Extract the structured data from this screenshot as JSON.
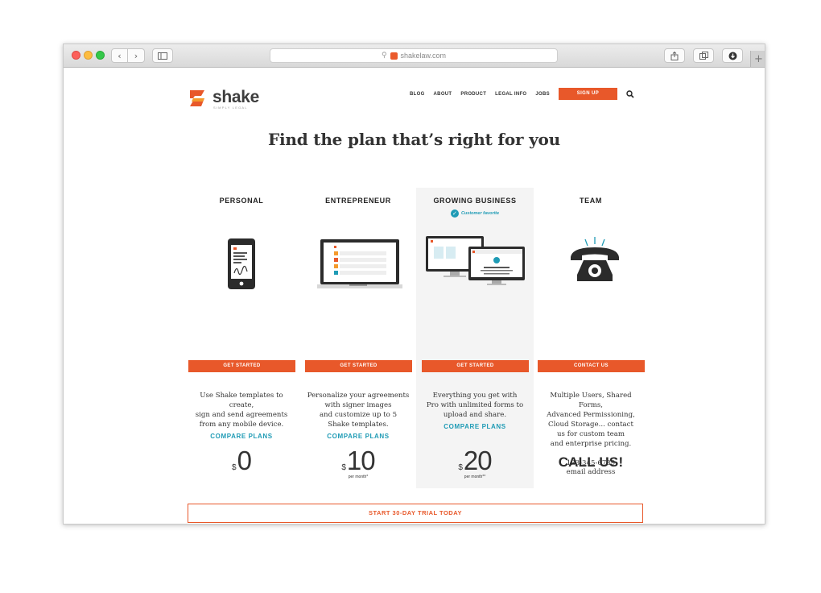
{
  "browser": {
    "url": "shakelaw.com",
    "back_glyph": "‹",
    "forward_glyph": "›",
    "new_tab_glyph": "+"
  },
  "header": {
    "logo_word": "shake",
    "logo_tagline": "SIMPLY LEGAL",
    "nav": [
      "BLOG",
      "ABOUT",
      "PRODUCT",
      "LEGAL INFO",
      "JOBS"
    ],
    "signup_label": "SIGN UP"
  },
  "headline": "Find the plan that’s right for you",
  "plans": [
    {
      "name": "PERSONAL",
      "currency": "$",
      "amount": "0",
      "period": "",
      "cta": "GET STARTED",
      "description": [
        "Use Shake templates to create,",
        "sign and send agreements",
        "from any mobile device."
      ],
      "compare": "COMPARE PLANS"
    },
    {
      "name": "ENTREPRENEUR",
      "currency": "$",
      "amount": "10",
      "period": "per month*",
      "cta": "GET STARTED",
      "description": [
        "Personalize your agreements",
        "with signer images",
        "and customize up to 5",
        "Shake templates."
      ],
      "compare": "COMPARE PLANS"
    },
    {
      "name": "GROWING BUSINESS",
      "badge": "Customer favorite",
      "currency": "$",
      "amount": "20",
      "period": "per month**",
      "cta": "GET STARTED",
      "description": [
        "Everything you get with",
        "Pro with unlimited forms to",
        "upload and share."
      ],
      "compare": "COMPARE PLANS"
    },
    {
      "name": "TEAM",
      "price_text": "CALL US!",
      "cta": "CONTACT US",
      "description": [
        "Multiple Users, Shared Forms,",
        "Advanced Permissioning,",
        "Cloud Storage... contact",
        "us for custom team",
        "and enterprise pricing."
      ],
      "phone": "123-345-6789",
      "email": "email address"
    }
  ],
  "trial_label": "START 30-DAY TRIAL TODAY",
  "colors": {
    "accent": "#e8582a",
    "link": "#1f9bb5",
    "highlight_bg": "#f4f4f4"
  }
}
